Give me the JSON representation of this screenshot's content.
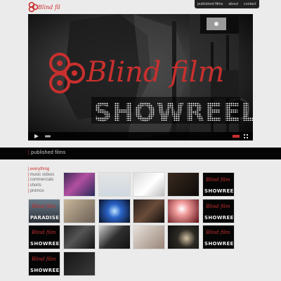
{
  "logo": {
    "text": "Blind film"
  },
  "nav": {
    "items": [
      "published films",
      "about",
      "contact"
    ]
  },
  "video": {
    "brand_text": "Blind film",
    "title_text": "SHOWREEL"
  },
  "section": {
    "title": "published films"
  },
  "filters": [
    "everything",
    "music videos",
    "commercials",
    "shorts",
    "promos"
  ],
  "active_filter": "everything",
  "thumbs": [
    {
      "name": "thumb-neon-singer",
      "label": ""
    },
    {
      "name": "thumb-man-blue-shirt",
      "label": ""
    },
    {
      "name": "thumb-woman-hair",
      "label": ""
    },
    {
      "name": "thumb-dark-portrait",
      "label": ""
    },
    {
      "name": "thumb-showreel-1",
      "label": "SHOWREEL"
    },
    {
      "name": "thumb-paradise",
      "label": "PARADISE"
    },
    {
      "name": "thumb-office",
      "label": ""
    },
    {
      "name": "thumb-blue-lights",
      "label": ""
    },
    {
      "name": "thumb-man-dark",
      "label": ""
    },
    {
      "name": "thumb-smoke-red",
      "label": ""
    },
    {
      "name": "thumb-showreel-2",
      "label": "SHOWREEL"
    },
    {
      "name": "thumb-showreel-3",
      "label": "SHOWREEL"
    },
    {
      "name": "thumb-chef",
      "label": ""
    },
    {
      "name": "thumb-couple",
      "label": ""
    },
    {
      "name": "thumb-woman-closeup",
      "label": ""
    },
    {
      "name": "thumb-bokeh",
      "label": ""
    },
    {
      "name": "thumb-showreel-4",
      "label": "SHOWREEL"
    },
    {
      "name": "thumb-showreel-5",
      "label": "SHOWREEL"
    },
    {
      "name": "thumb-night-scene",
      "label": ""
    },
    {
      "name": "thumb-showreel-6",
      "label": "SHOWREEL"
    },
    {
      "name": "thumb-cook",
      "label": ""
    }
  ],
  "colors": {
    "accent": "#c8302e",
    "background": "#ebebeb",
    "band": "#050505"
  }
}
